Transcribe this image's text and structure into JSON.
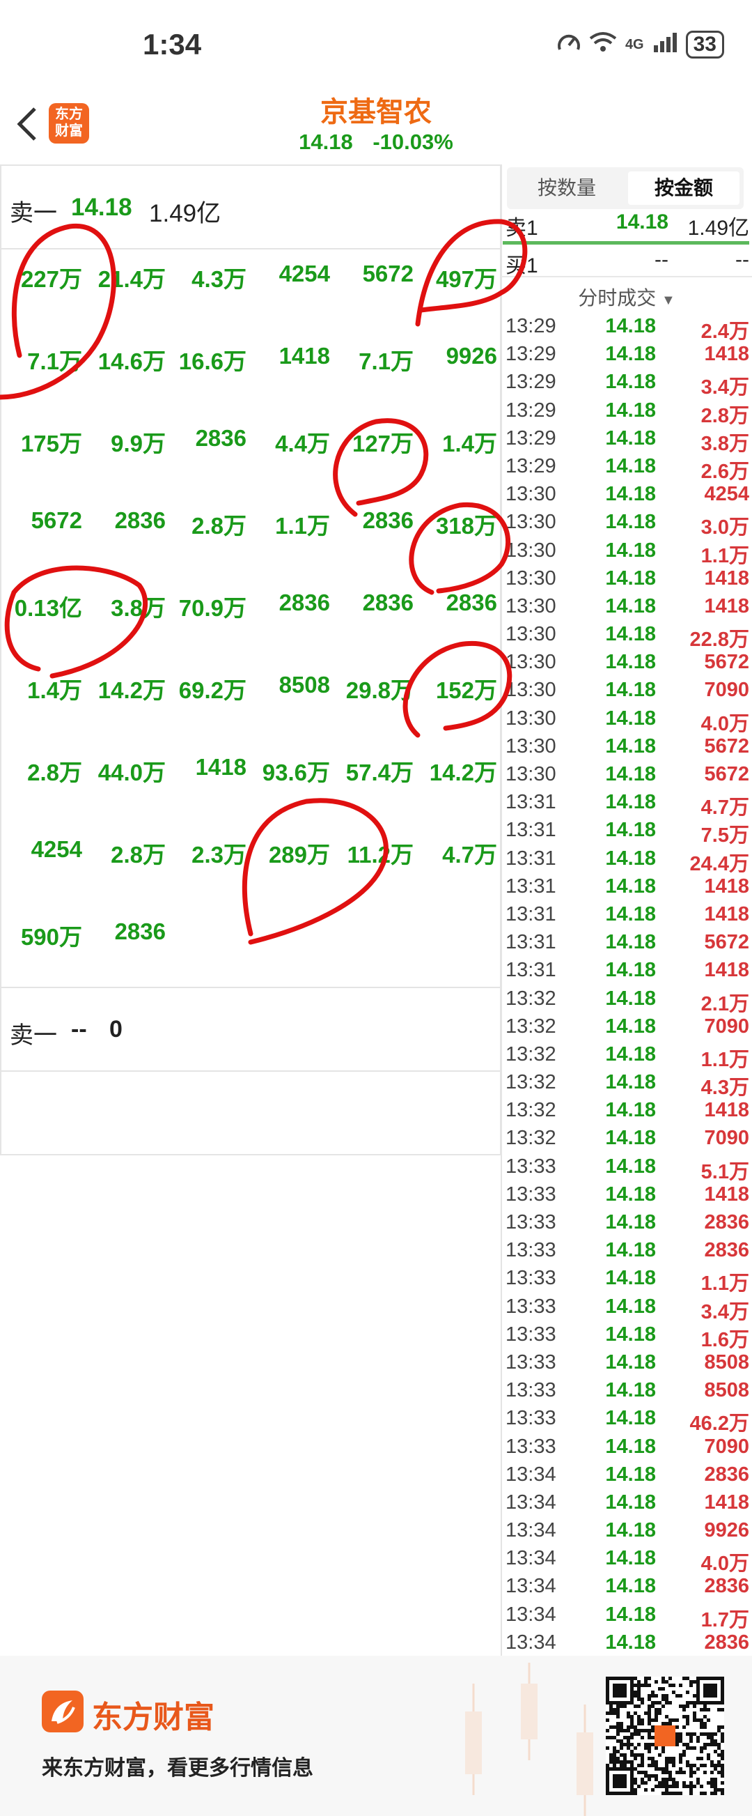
{
  "status_bar": {
    "time": "1:34",
    "network": "4G",
    "battery": "33"
  },
  "header": {
    "stock_name": "京基智农",
    "price": "14.18",
    "change_pct": "-10.03%",
    "logo_text_1": "东方",
    "logo_text_2": "财富"
  },
  "order_book_left": {
    "sell_label": "卖一",
    "sell_price": "14.18",
    "sell_amount": "1.49亿",
    "cells": [
      [
        "227万",
        "21.4万",
        "4.3万",
        "4254",
        "5672",
        "497万"
      ],
      [
        "7.1万",
        "14.6万",
        "16.6万",
        "1418",
        "7.1万",
        "9926"
      ],
      [
        "175万",
        "9.9万",
        "2836",
        "4.4万",
        "127万",
        "1.4万"
      ],
      [
        "5672",
        "2836",
        "2.8万",
        "1.1万",
        "2836",
        "318万"
      ],
      [
        "0.13亿",
        "3.8万",
        "70.9万",
        "2836",
        "2836",
        "2836"
      ],
      [
        "1.4万",
        "14.2万",
        "69.2万",
        "8508",
        "29.8万",
        "152万"
      ],
      [
        "2.8万",
        "44.0万",
        "1418",
        "93.6万",
        "57.4万",
        "14.2万"
      ],
      [
        "4254",
        "2.8万",
        "2.3万",
        "289万",
        "11.2万",
        "4.7万"
      ],
      [
        "590万",
        "2836"
      ]
    ],
    "buy_label": "卖一",
    "buy_value1": "--",
    "buy_value2": "0"
  },
  "right_panel": {
    "tabs": [
      "按数量",
      "按金额"
    ],
    "active_tab": "按金额",
    "ask": {
      "label": "卖1",
      "price": "14.18",
      "amount": "1.49亿"
    },
    "bid": {
      "label": "买1",
      "price": "--",
      "amount": "--"
    },
    "ticks_header": "分时成交",
    "ticks": [
      [
        "13:29",
        "14.18",
        "2.4万"
      ],
      [
        "13:29",
        "14.18",
        "1418"
      ],
      [
        "13:29",
        "14.18",
        "3.4万"
      ],
      [
        "13:29",
        "14.18",
        "2.8万"
      ],
      [
        "13:29",
        "14.18",
        "3.8万"
      ],
      [
        "13:29",
        "14.18",
        "2.6万"
      ],
      [
        "13:30",
        "14.18",
        "4254"
      ],
      [
        "13:30",
        "14.18",
        "3.0万"
      ],
      [
        "13:30",
        "14.18",
        "1.1万"
      ],
      [
        "13:30",
        "14.18",
        "1418"
      ],
      [
        "13:30",
        "14.18",
        "1418"
      ],
      [
        "13:30",
        "14.18",
        "22.8万"
      ],
      [
        "13:30",
        "14.18",
        "5672"
      ],
      [
        "13:30",
        "14.18",
        "7090"
      ],
      [
        "13:30",
        "14.18",
        "4.0万"
      ],
      [
        "13:30",
        "14.18",
        "5672"
      ],
      [
        "13:30",
        "14.18",
        "5672"
      ],
      [
        "13:31",
        "14.18",
        "4.7万"
      ],
      [
        "13:31",
        "14.18",
        "7.5万"
      ],
      [
        "13:31",
        "14.18",
        "24.4万"
      ],
      [
        "13:31",
        "14.18",
        "1418"
      ],
      [
        "13:31",
        "14.18",
        "1418"
      ],
      [
        "13:31",
        "14.18",
        "5672"
      ],
      [
        "13:31",
        "14.18",
        "1418"
      ],
      [
        "13:32",
        "14.18",
        "2.1万"
      ],
      [
        "13:32",
        "14.18",
        "7090"
      ],
      [
        "13:32",
        "14.18",
        "1.1万"
      ],
      [
        "13:32",
        "14.18",
        "4.3万"
      ],
      [
        "13:32",
        "14.18",
        "1418"
      ],
      [
        "13:32",
        "14.18",
        "7090"
      ],
      [
        "13:33",
        "14.18",
        "5.1万"
      ],
      [
        "13:33",
        "14.18",
        "1418"
      ],
      [
        "13:33",
        "14.18",
        "2836"
      ],
      [
        "13:33",
        "14.18",
        "2836"
      ],
      [
        "13:33",
        "14.18",
        "1.1万"
      ],
      [
        "13:33",
        "14.18",
        "3.4万"
      ],
      [
        "13:33",
        "14.18",
        "1.6万"
      ],
      [
        "13:33",
        "14.18",
        "8508"
      ],
      [
        "13:33",
        "14.18",
        "8508"
      ],
      [
        "13:33",
        "14.18",
        "46.2万"
      ],
      [
        "13:33",
        "14.18",
        "7090"
      ],
      [
        "13:34",
        "14.18",
        "2836"
      ],
      [
        "13:34",
        "14.18",
        "1418"
      ],
      [
        "13:34",
        "14.18",
        "9926"
      ],
      [
        "13:34",
        "14.18",
        "4.0万"
      ],
      [
        "13:34",
        "14.18",
        "2836"
      ],
      [
        "13:34",
        "14.18",
        "1.7万"
      ],
      [
        "13:34",
        "14.18",
        "2836"
      ]
    ]
  },
  "footer": {
    "brand": "东方财富",
    "tagline": "来东方财富，看更多行情信息"
  },
  "colors": {
    "accent_orange": "#ee6a13",
    "down_green": "#1a9a1a",
    "up_red": "#d7373a",
    "annotation_red": "#e01010"
  }
}
